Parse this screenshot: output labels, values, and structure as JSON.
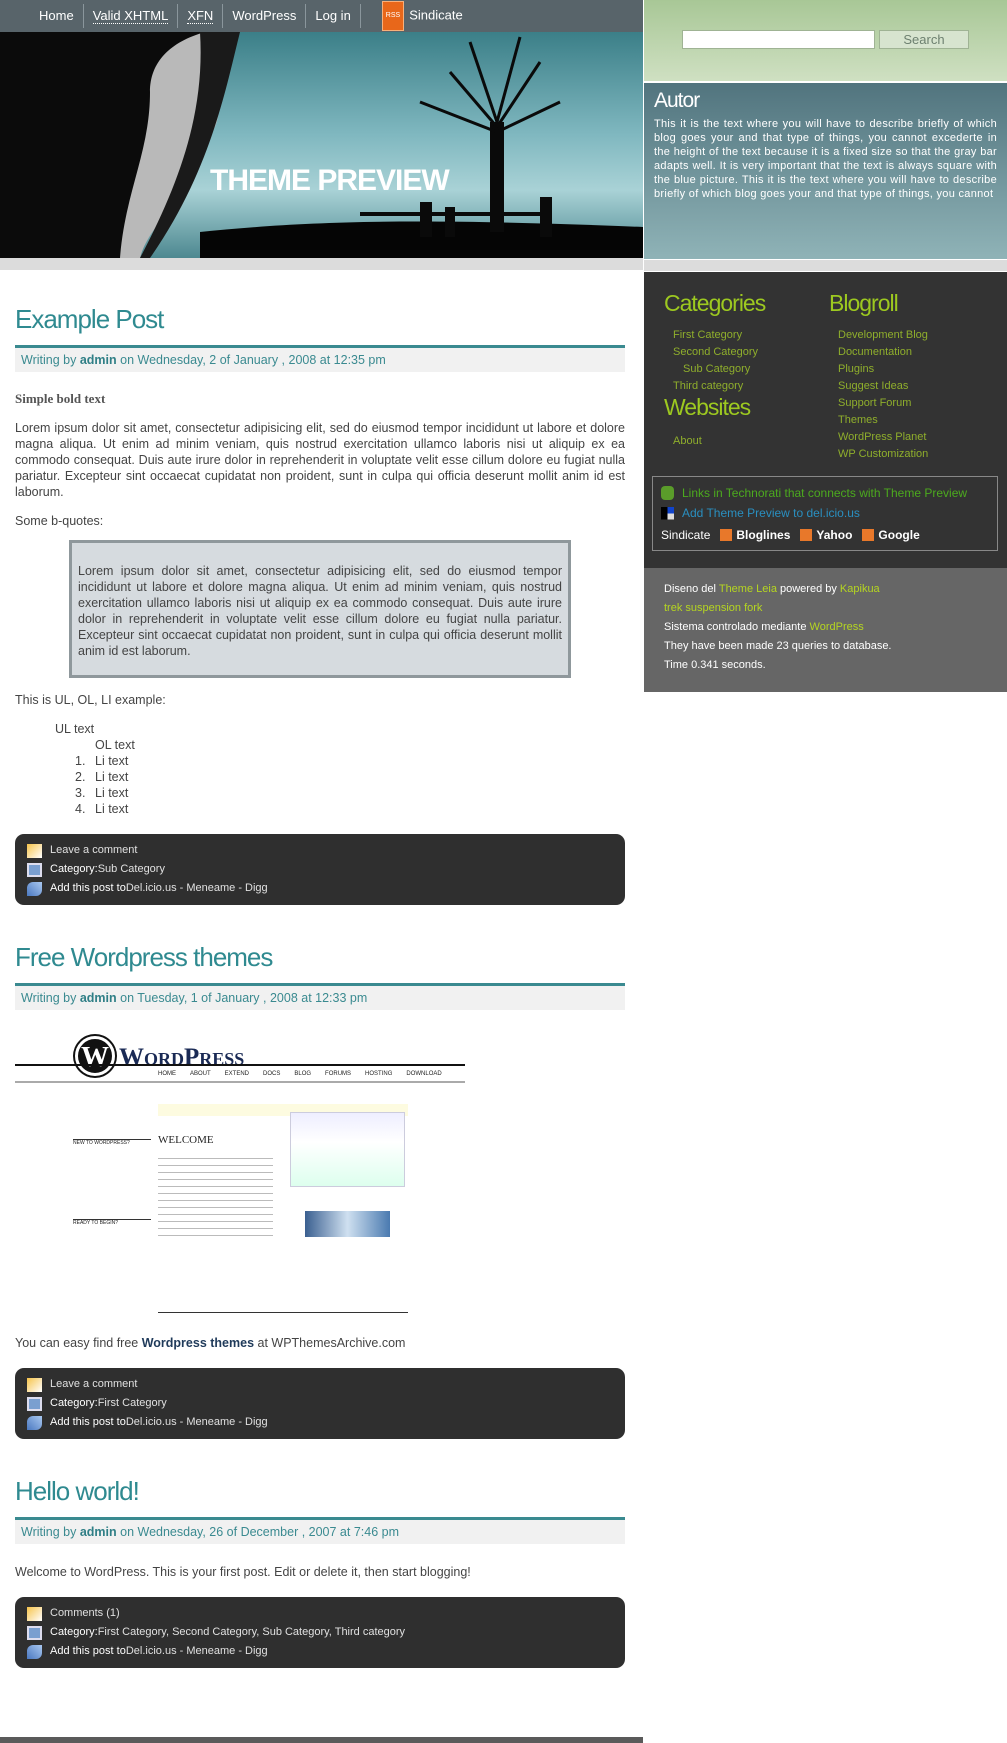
{
  "nav": {
    "items": [
      "Home",
      "Valid XHTML",
      "XFN",
      "WordPress",
      "Log in"
    ],
    "rss_badge": "RSS",
    "syndicate": "Sindicate"
  },
  "banner": {
    "title": "THEME PREVIEW"
  },
  "search": {
    "button": "Search",
    "value": ""
  },
  "autor": {
    "title": "Autor",
    "text": "This it is the text where you will have to describe briefly of which blog goes your and that type of things, you cannot excederte in the height of the text because it is a fixed size so that the gray bar adapts well. It is very important that the text is always square with the blue picture. This it is the text where you will have to describe briefly of which blog goes your and that type of things, you cannot"
  },
  "categories": {
    "title": "Categories",
    "items": [
      "First Category",
      "Second Category",
      "Sub Category",
      "Third category"
    ]
  },
  "websites": {
    "title": "Websites",
    "items": [
      "About"
    ]
  },
  "blogroll": {
    "title": "Blogroll",
    "items": [
      "Development Blog",
      "Documentation",
      "Plugins",
      "Suggest Ideas",
      "Support Forum",
      "Themes",
      "WordPress Planet",
      "WP Customization"
    ]
  },
  "technorati": {
    "link": "Links in Technorati that connects with Theme Preview",
    "delicious": "Add Theme Preview to del.icio.us",
    "syndicate": "Sindicate",
    "feeds": [
      "Bloglines",
      "Yahoo",
      "Google"
    ]
  },
  "footer": {
    "design_prefix": "Diseno del ",
    "theme": "Theme Leia",
    "powered": " powered by ",
    "kapikua": "Kapikua",
    "trek": "trek suspension fork",
    "system": "Sistema controlado mediante ",
    "wordpress": "WordPress",
    "queries": "They have been made 23 queries to database.",
    "time": "Time 0.341 seconds."
  },
  "colors": {
    "accent": "#2f8a90",
    "sidebar_green": "#9dc920",
    "dark": "#333333"
  },
  "posts": [
    {
      "title": "Example Post",
      "meta_prefix": "Writing by ",
      "author": "admin",
      "meta_suffix": " on Wednesday, 2 of January , 2008 at 12:35 pm",
      "bold": "Simple bold text",
      "para": "Lorem ipsum dolor sit amet, consectetur adipisicing elit, sed do eiusmod tempor incididunt ut labore et dolore magna aliqua. Ut enim ad minim veniam, quis nostrud exercitation ullamco laboris nisi ut aliquip ex ea commodo consequat. Duis aute irure dolor in reprehenderit in voluptate velit esse cillum dolore eu fugiat nulla pariatur. Excepteur sint occaecat cupidatat non proident, sunt in culpa qui officia deserunt mollit anim id est laborum.",
      "bq_intro": "Some b-quotes:",
      "quote": "Lorem ipsum dolor sit amet, consectetur adipisicing elit, sed do eiusmod tempor incididunt ut labore et dolore magna aliqua. Ut enim ad minim veniam, quis nostrud exercitation ullamco laboris nisi ut aliquip ex ea commodo consequat. Duis aute irure dolor in reprehenderit in voluptate velit esse cillum dolore eu fugiat nulla pariatur. Excepteur sint occaecat cupidatat non proident, sunt in culpa qui officia deserunt mollit anim id est laborum.",
      "list_intro": "This is UL, OL, LI example:",
      "ul": "UL text",
      "ol": "OL text",
      "li": [
        "1.",
        "Li text",
        "2.",
        "Li text",
        "3.",
        "Li text",
        "4.",
        "Li text"
      ],
      "comment": "Leave a comment",
      "cat_label": "Category: ",
      "cats": "Sub Category",
      "add": "Add this post to ",
      "share": "Del.icio.us - Meneame - Digg"
    },
    {
      "title": "Free Wordpress themes",
      "meta_prefix": "Writing by ",
      "author": "admin",
      "meta_suffix": " on Tuesday, 1 of January , 2008 at 12:33 pm",
      "text_prefix": "You can easy find free ",
      "text_bold": "Wordpress themes",
      "text_suffix": " at WPThemesArchive.com",
      "comment": "Leave a comment",
      "cat_label": "Category: ",
      "cats": "First Category",
      "add": "Add this post to ",
      "share": "Del.icio.us - Meneame - Digg",
      "image": {
        "logo": "WordPress",
        "nav": [
          "HOME",
          "ABOUT",
          "EXTEND",
          "DOCS",
          "BLOG",
          "FORUMS",
          "HOSTING",
          "DOWNLOAD"
        ],
        "welcome": "WELCOME",
        "new": "NEW TO WORDPRESS?",
        "ready": "READY TO BEGIN?"
      }
    },
    {
      "title": "Hello world!",
      "meta_prefix": "Writing by ",
      "author": "admin",
      "meta_suffix": " on Wednesday, 26 of December , 2007 at 7:46 pm",
      "text": "Welcome to WordPress. This is your first post. Edit or delete it, then start blogging!",
      "comment": "Comments (1)",
      "cat_label": "Category: ",
      "cats": "First Category, Second Category, Sub Category, Third category",
      "add": "Add this post to ",
      "share": "Del.icio.us - Meneame - Digg"
    }
  ]
}
